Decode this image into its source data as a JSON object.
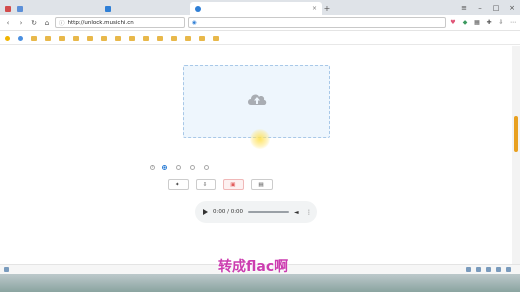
{
  "tabs": [
    {
      "label": "",
      "color": "#d24b4b"
    },
    {
      "label": "",
      "color": "#5b8fd8"
    },
    {
      "label": "",
      "color": "#2f7fd6"
    },
    {
      "label": "",
      "color": "#2f7fd6"
    }
  ],
  "address": {
    "url": "http://unlock.musichi.cn",
    "search_text": ""
  },
  "bookmarks": [
    "",
    "",
    "",
    "",
    "",
    "",
    "",
    "",
    "",
    "",
    "",
    "",
    "",
    "",
    "",
    ""
  ],
  "dropzone": {
    "text": "",
    "link": ""
  },
  "hint_lines": [
    "",
    ""
  ],
  "options": {
    "label": "",
    "choices": [
      {
        "label": "",
        "selected": true
      },
      {
        "label": "",
        "selected": false
      },
      {
        "label": "",
        "selected": false
      },
      {
        "label": "",
        "selected": false
      }
    ]
  },
  "buttons": {
    "unlock_all": "",
    "download_all": "",
    "clear_all": "",
    "save_file": ""
  },
  "player": {
    "time": "0:00 / 0:00"
  },
  "table_headers": [
    "",
    "",
    "",
    "",
    ""
  ],
  "statusbar": {
    "left_text": "",
    "items": [
      "",
      "",
      "",
      "",
      ""
    ],
    "zoom": ""
  },
  "caption": "转成flac啊",
  "colors": {
    "accent": "#2f7fd6",
    "danger": "#e25c5c",
    "caption": "#cc3db0"
  }
}
